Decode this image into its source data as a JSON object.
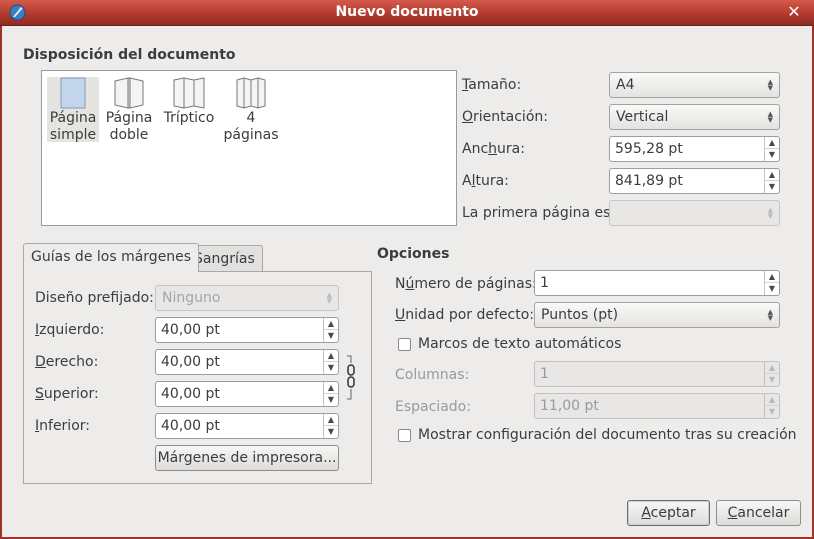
{
  "window": {
    "title": "Nuevo documento"
  },
  "layout_section": {
    "heading": "Disposición del documento",
    "options": [
      {
        "line1": "Página",
        "line2": "simple"
      },
      {
        "line1": "Página",
        "line2": "doble"
      },
      {
        "line1": "Tríptico",
        "line2": ""
      },
      {
        "line1": "4",
        "line2": "páginas"
      }
    ]
  },
  "size_panel": {
    "tamano": {
      "label_u": "T",
      "label_rest": "amaño:",
      "value": "A4"
    },
    "orientacion": {
      "label_u": "O",
      "label_rest": "rientación:",
      "value": "Vertical"
    },
    "anchura": {
      "label_pre": "Anc",
      "label_u": "h",
      "label_rest": "ura:",
      "value": "595,28 pt"
    },
    "altura": {
      "label_pre": "A",
      "label_u": "l",
      "label_rest": "tura:",
      "value": "841,89 pt"
    },
    "primera": {
      "label": "La primera página es:",
      "value": ""
    }
  },
  "tabs": {
    "margins": "Guías de los márgenes",
    "bleeds": "Sangrías"
  },
  "margins": {
    "preset": {
      "label": "Diseño prefijado:",
      "value": "Ninguno"
    },
    "izquierdo": {
      "label_u": "I",
      "label_rest": "zquierdo:",
      "value": "40,00 pt"
    },
    "derecho": {
      "label_u": "D",
      "label_rest": "erecho:",
      "value": "40,00 pt"
    },
    "superior": {
      "label_u": "S",
      "label_rest": "uperior:",
      "value": "40,00 pt"
    },
    "inferior": {
      "label_u": "I",
      "label_rest": "nferior:",
      "value": "40,00 pt"
    },
    "printer_button": "Márgenes de impresora..."
  },
  "options": {
    "heading": "Opciones",
    "num_pages": {
      "label_pre": "N",
      "label_u": "ú",
      "label_rest": "mero de páginas:",
      "value": "1"
    },
    "unit": {
      "label_u": "U",
      "label_rest": "nidad por defecto:",
      "value": "Puntos (pt)"
    },
    "auto_frames": {
      "label": "Marcos de texto automáticos",
      "checked": false
    },
    "columns": {
      "label": "Columnas:",
      "value": "1"
    },
    "spacing": {
      "label": "Espaciado:",
      "value": "11,00 pt"
    },
    "show_settings": {
      "label": "Mostrar configuración del documento tras su creación",
      "checked": false
    }
  },
  "buttons": {
    "ok": {
      "u": "A",
      "rest": "ceptar"
    },
    "cancel": {
      "u": "C",
      "rest": "ancelar"
    }
  }
}
